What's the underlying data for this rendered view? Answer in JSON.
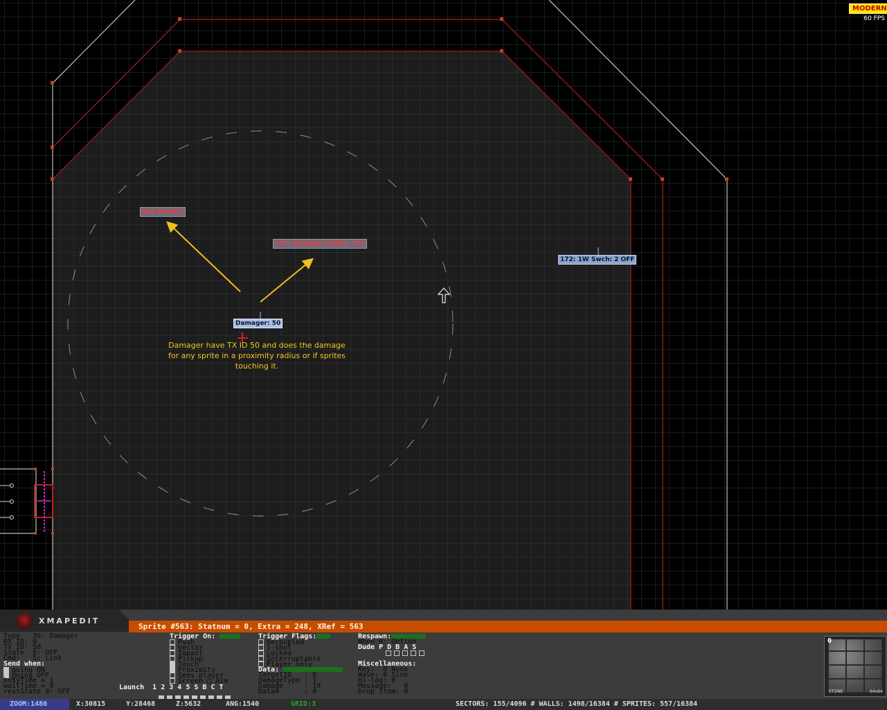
{
  "top_badges": {
    "mode": "MODERN",
    "fps": "60 FPS"
  },
  "map": {
    "labels": {
      "axe_zombie": "Axe Zombie",
      "shotgun_cultist": "171: Shotgun Cultist: 172",
      "switch": "172: 1W Swch: 2 OFF",
      "damager": "Damager: 50"
    },
    "note": "Damager have TX ID 50 and does the damage for any sprite in a proximity radius or if sprites touching it.",
    "colors": {
      "grid": "#3a3a3a",
      "sector_fill": "#1e1e1e",
      "red_wall": "#8b1a1a",
      "white_wall": "#e6e6e6",
      "arrow": "#f0c020",
      "circle": "#7a90c0"
    }
  },
  "panel": {
    "app_name": "XMAPEDIT",
    "title": "Sprite #563: Statnum = 0, Extra = 248, XRef = 563",
    "props": [
      "Type   36: Damager",
      "RX ID: 0",
      "TX ID: 50",
      "State  0: OFF",
      "Cmd:   5: Link"
    ],
    "send_when_header": "Send when:",
    "send_when": [
      "going ON",
      "going OFF"
    ],
    "timers": [
      "busyTime = 1",
      "waitTime = 0",
      "restState 0: OFF"
    ],
    "trigger_on_header": "Trigger On:",
    "trigger_on": [
      {
        "label": "Push",
        "on": false
      },
      {
        "label": "Vector",
        "on": false
      },
      {
        "label": "Impact",
        "on": false
      },
      {
        "label": "Pickup",
        "on": false
      },
      {
        "label": "Touch",
        "on": true
      },
      {
        "label": "Proximity",
        "on": true
      },
      {
        "label": "Sees player",
        "on": false
      },
      {
        "label": "Screen □ Aim",
        "on": false
      }
    ],
    "launch_label": "Launch",
    "launch_keys": "1 2 3 4 5 S B C T",
    "trigger_flags_header": "Trigger Flags:",
    "trigger_flags": [
      {
        "label": "Decoupled",
        "on": false
      },
      {
        "label": "1-shot",
        "on": false
      },
      {
        "label": "Locked",
        "on": false
      },
      {
        "label": "Interruptable",
        "on": false
      },
      {
        "label": "Player only",
        "on": false
      }
    ],
    "data_header": "Data:",
    "data": [
      "TargetID   : 0",
      "DamageType : 1",
      "Damage     : 10",
      "Data4      : 0"
    ],
    "respawn_header": "Respawn:",
    "respawn": [
      "When 0: Option",
      "Dude P D B A S"
    ],
    "misc_header": "Miscellaneous:",
    "misc": [
      "Key:  0 None",
      "Wave: 0 Sine",
      "Hi-tag: 0",
      "Message:   0",
      "Drop item: 0"
    ],
    "thumb": {
      "number": "0",
      "name": "STONE",
      "size": "64x64"
    }
  },
  "status": {
    "zoom": "ZOOM:1486",
    "x": "X:30815",
    "y": "Y:28468",
    "z": "Z:5632",
    "ang": "ANG:1540",
    "grid": "GRID:3",
    "counts": "SECTORS: 155/4096 # WALLS: 1498/16384 # SPRITES: 557/16384"
  }
}
